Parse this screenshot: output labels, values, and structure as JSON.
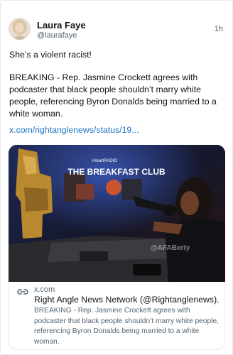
{
  "author": {
    "name": "Laura Faye",
    "handle": "@laurafaye",
    "time": "1h"
  },
  "post": {
    "text1": "She’s a violent racist!",
    "text2": "BREAKING - Rep. Jasmine Crockett agrees with podcaster that black people shouldn’t marry white people, referencing Byron Donalds being married to a white woman.",
    "link": "x.com/rightanglenews/status/19..."
  },
  "media": {
    "banner_top": "iHeartRADIO",
    "banner_title": "THE BREAKFAST CLUB",
    "watermark": "@AFABerty",
    "icon": "video-frame"
  },
  "preview": {
    "icon": "link-icon",
    "domain": "x.com",
    "title": "Right Angle News Network (@Rightanglenews)...",
    "description": "BREAKING - Rep. Jasmine Crockett agrees with podcaster that black people shouldn’t marry white people, referencing Byron Donalds being married to a white woman."
  },
  "colors": {
    "link": "#1d72c2",
    "secondary_text": "#536471",
    "border": "#e6e8eb"
  }
}
